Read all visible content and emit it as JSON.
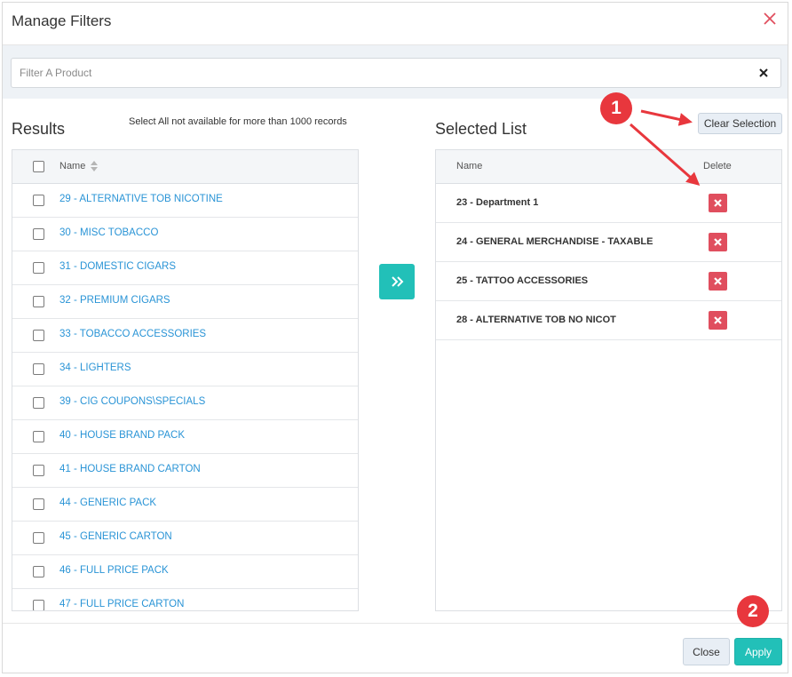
{
  "dialog": {
    "title": "Manage Filters",
    "close_icon": "close-icon"
  },
  "filter": {
    "placeholder": "Filter A Product",
    "value": "",
    "clear_icon": "clear-x-icon"
  },
  "results": {
    "title": "Results",
    "note": "Select All not available for more than 1000 records",
    "column_name": "Name",
    "sort_icon": "sort-icon",
    "rows": [
      "29 - ALTERNATIVE TOB NICOTINE",
      "30 - MISC TOBACCO",
      "31 - DOMESTIC CIGARS",
      "32 - PREMIUM CIGARS",
      "33 - TOBACCO ACCESSORIES",
      "34 - LIGHTERS",
      "39 - CIG COUPONS\\SPECIALS",
      "40 - HOUSE BRAND PACK",
      "41 - HOUSE BRAND CARTON",
      "44 - GENERIC PACK",
      "45 - GENERIC CARTON",
      "46 - FULL PRICE PACK",
      "47 - FULL PRICE CARTON"
    ]
  },
  "move_button_icon": "double-chevron-right-icon",
  "selected": {
    "title": "Selected List",
    "clear_label": "Clear Selection",
    "column_name": "Name",
    "column_delete": "Delete",
    "delete_icon": "delete-x-icon",
    "rows": [
      "23 - Department 1",
      "24 - GENERAL MERCHANDISE - TAXABLE",
      "25 - TATTOO ACCESSORIES",
      "28 - ALTERNATIVE TOB NO NICOT"
    ]
  },
  "footer": {
    "close_label": "Close",
    "apply_label": "Apply"
  },
  "annotations": {
    "marker_1": "1",
    "marker_2": "2",
    "color": "#e8373d"
  },
  "colors": {
    "accent": "#22c0b8",
    "link": "#2a94d6",
    "delete": "#e04e5e"
  }
}
